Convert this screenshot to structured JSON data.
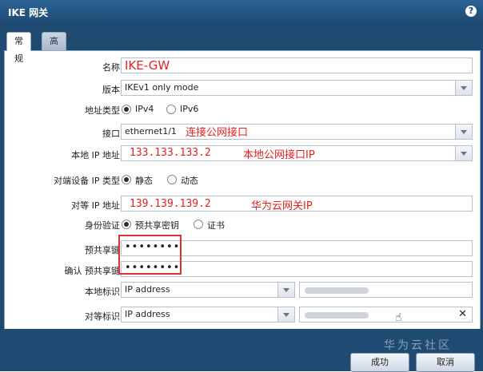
{
  "window": {
    "title": "IKE 网关",
    "help_icon": "?"
  },
  "tabs": [
    {
      "label": "常规"
    },
    {
      "label": "高级选项"
    }
  ],
  "form": {
    "name": {
      "label": "名称",
      "value": "IKE-GW"
    },
    "version": {
      "label": "版本",
      "value": "IKEv1 only mode"
    },
    "address_type": {
      "label": "地址类型",
      "options": [
        "IPv4",
        "IPv6"
      ],
      "selected": "IPv4"
    },
    "interface": {
      "label": "接口",
      "value": "ethernet1/1",
      "annotation": "连接公网接口"
    },
    "local_ip": {
      "label": "本地 IP 地址",
      "value": "133.133.133.2",
      "annotation": "本地公网接口IP"
    },
    "peer_ip_type": {
      "label": "对端设备 IP 类型",
      "options": [
        "静态",
        "动态"
      ],
      "selected": "静态"
    },
    "peer_ip": {
      "label": "对等 IP 地址",
      "value": "139.139.139.2",
      "annotation": "华为云网关IP"
    },
    "auth": {
      "label": "身份验证",
      "options": [
        "预共享密钥",
        "证书"
      ],
      "selected": "预共享密钥"
    },
    "psk": {
      "label": "预共享键",
      "value": "••••••••"
    },
    "psk_confirm": {
      "label": "确认 预共享键",
      "value": "••••••••"
    },
    "local_id": {
      "label": "本地标识",
      "type": "IP address"
    },
    "peer_id": {
      "label": "对等标识",
      "type": "IP address",
      "clear": "✕"
    }
  },
  "buttons": {
    "ok": "成功",
    "cancel": "取消"
  },
  "watermark": "华为云社区"
}
